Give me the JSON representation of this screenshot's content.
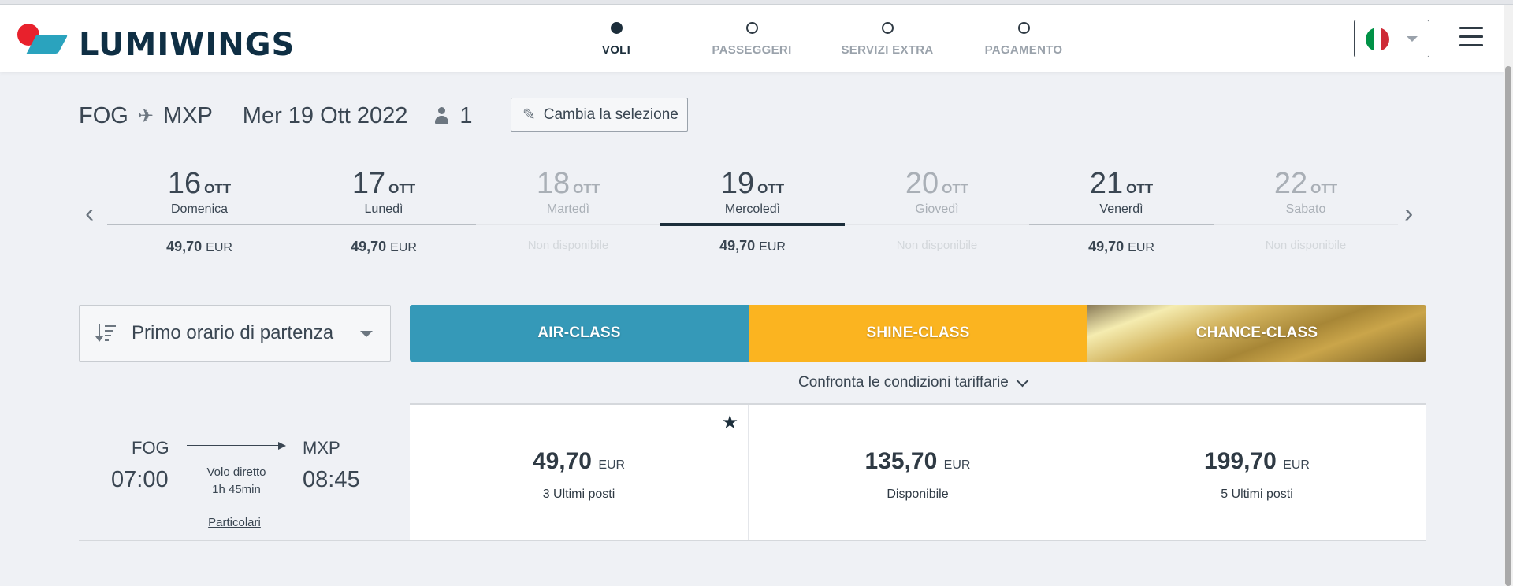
{
  "brand": {
    "name": "LUMIWINGS"
  },
  "steps": [
    {
      "label": "VOLI",
      "active": true
    },
    {
      "label": "PASSEGGERI",
      "active": false
    },
    {
      "label": "SERVIZI EXTRA",
      "active": false
    },
    {
      "label": "PAGAMENTO",
      "active": false
    }
  ],
  "language": {
    "flag": "italy-flag-icon",
    "colors": [
      "#009246",
      "#ffffff",
      "#ce2b37"
    ]
  },
  "search": {
    "origin": "FOG",
    "destination": "MXP",
    "date": "Mer 19 Ott 2022",
    "passengers": "1",
    "change_label": "Cambia la selezione"
  },
  "dates": [
    {
      "day": "16",
      "month": "OTT",
      "weekday": "Domenica",
      "price": "49,70",
      "currency": "EUR",
      "available": true
    },
    {
      "day": "17",
      "month": "OTT",
      "weekday": "Lunedì",
      "price": "49,70",
      "currency": "EUR",
      "available": true
    },
    {
      "day": "18",
      "month": "OTT",
      "weekday": "Martedì",
      "unavailable_text": "Non disponibile",
      "available": false
    },
    {
      "day": "19",
      "month": "OTT",
      "weekday": "Mercoledì",
      "price": "49,70",
      "currency": "EUR",
      "available": true,
      "selected": true
    },
    {
      "day": "20",
      "month": "OTT",
      "weekday": "Giovedì",
      "unavailable_text": "Non disponibile",
      "available": false
    },
    {
      "day": "21",
      "month": "OTT",
      "weekday": "Venerdì",
      "price": "49,70",
      "currency": "EUR",
      "available": true
    },
    {
      "day": "22",
      "month": "OTT",
      "weekday": "Sabato",
      "unavailable_text": "Non disponibile",
      "available": false
    }
  ],
  "sort": {
    "label": "Primo orario di partenza"
  },
  "classes": [
    {
      "label": "AIR-CLASS",
      "color": "#3599b8"
    },
    {
      "label": "SHINE-CLASS",
      "color": "#fbb420"
    },
    {
      "label": "CHANCE-CLASS",
      "color": "#b8953f"
    }
  ],
  "compare_label": "Confronta le condizioni tariffarie",
  "flight": {
    "origin": "FOG",
    "destination": "MXP",
    "depart": "07:00",
    "arrive": "08:45",
    "type": "Volo diretto",
    "duration": "1h 45min",
    "details_label": "Particolari"
  },
  "fares": [
    {
      "amount": "49,70",
      "currency": "EUR",
      "availability": "3 Ultimi posti",
      "starred": true
    },
    {
      "amount": "135,70",
      "currency": "EUR",
      "availability": "Disponibile"
    },
    {
      "amount": "199,70",
      "currency": "EUR",
      "availability": "5 Ultimi posti"
    }
  ]
}
